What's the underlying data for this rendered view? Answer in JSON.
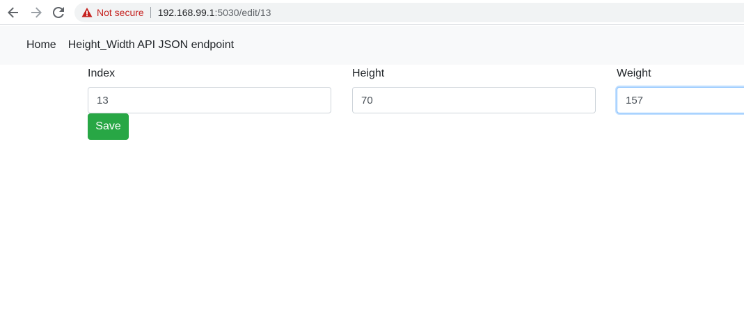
{
  "browser": {
    "security_label": "Not secure",
    "url_host": "192.168.99.1",
    "url_path": ":5030/edit/13",
    "colors": {
      "warning": "#c5221f",
      "omnibox_bg": "#f1f3f4"
    }
  },
  "navbar": {
    "links": [
      {
        "label": "Home"
      },
      {
        "label": "Height_Width API JSON endpoint"
      }
    ]
  },
  "form": {
    "fields": [
      {
        "label": "Index",
        "value": "13"
      },
      {
        "label": "Height",
        "value": "70"
      },
      {
        "label": "Weight",
        "value": "157"
      }
    ],
    "save_label": "Save",
    "colors": {
      "save_button": "#28a745",
      "focus_border": "#80bdff"
    }
  },
  "icons": {
    "back": "arrow-left-icon",
    "forward": "arrow-right-icon",
    "reload": "reload-icon",
    "security": "warning-triangle-icon"
  }
}
